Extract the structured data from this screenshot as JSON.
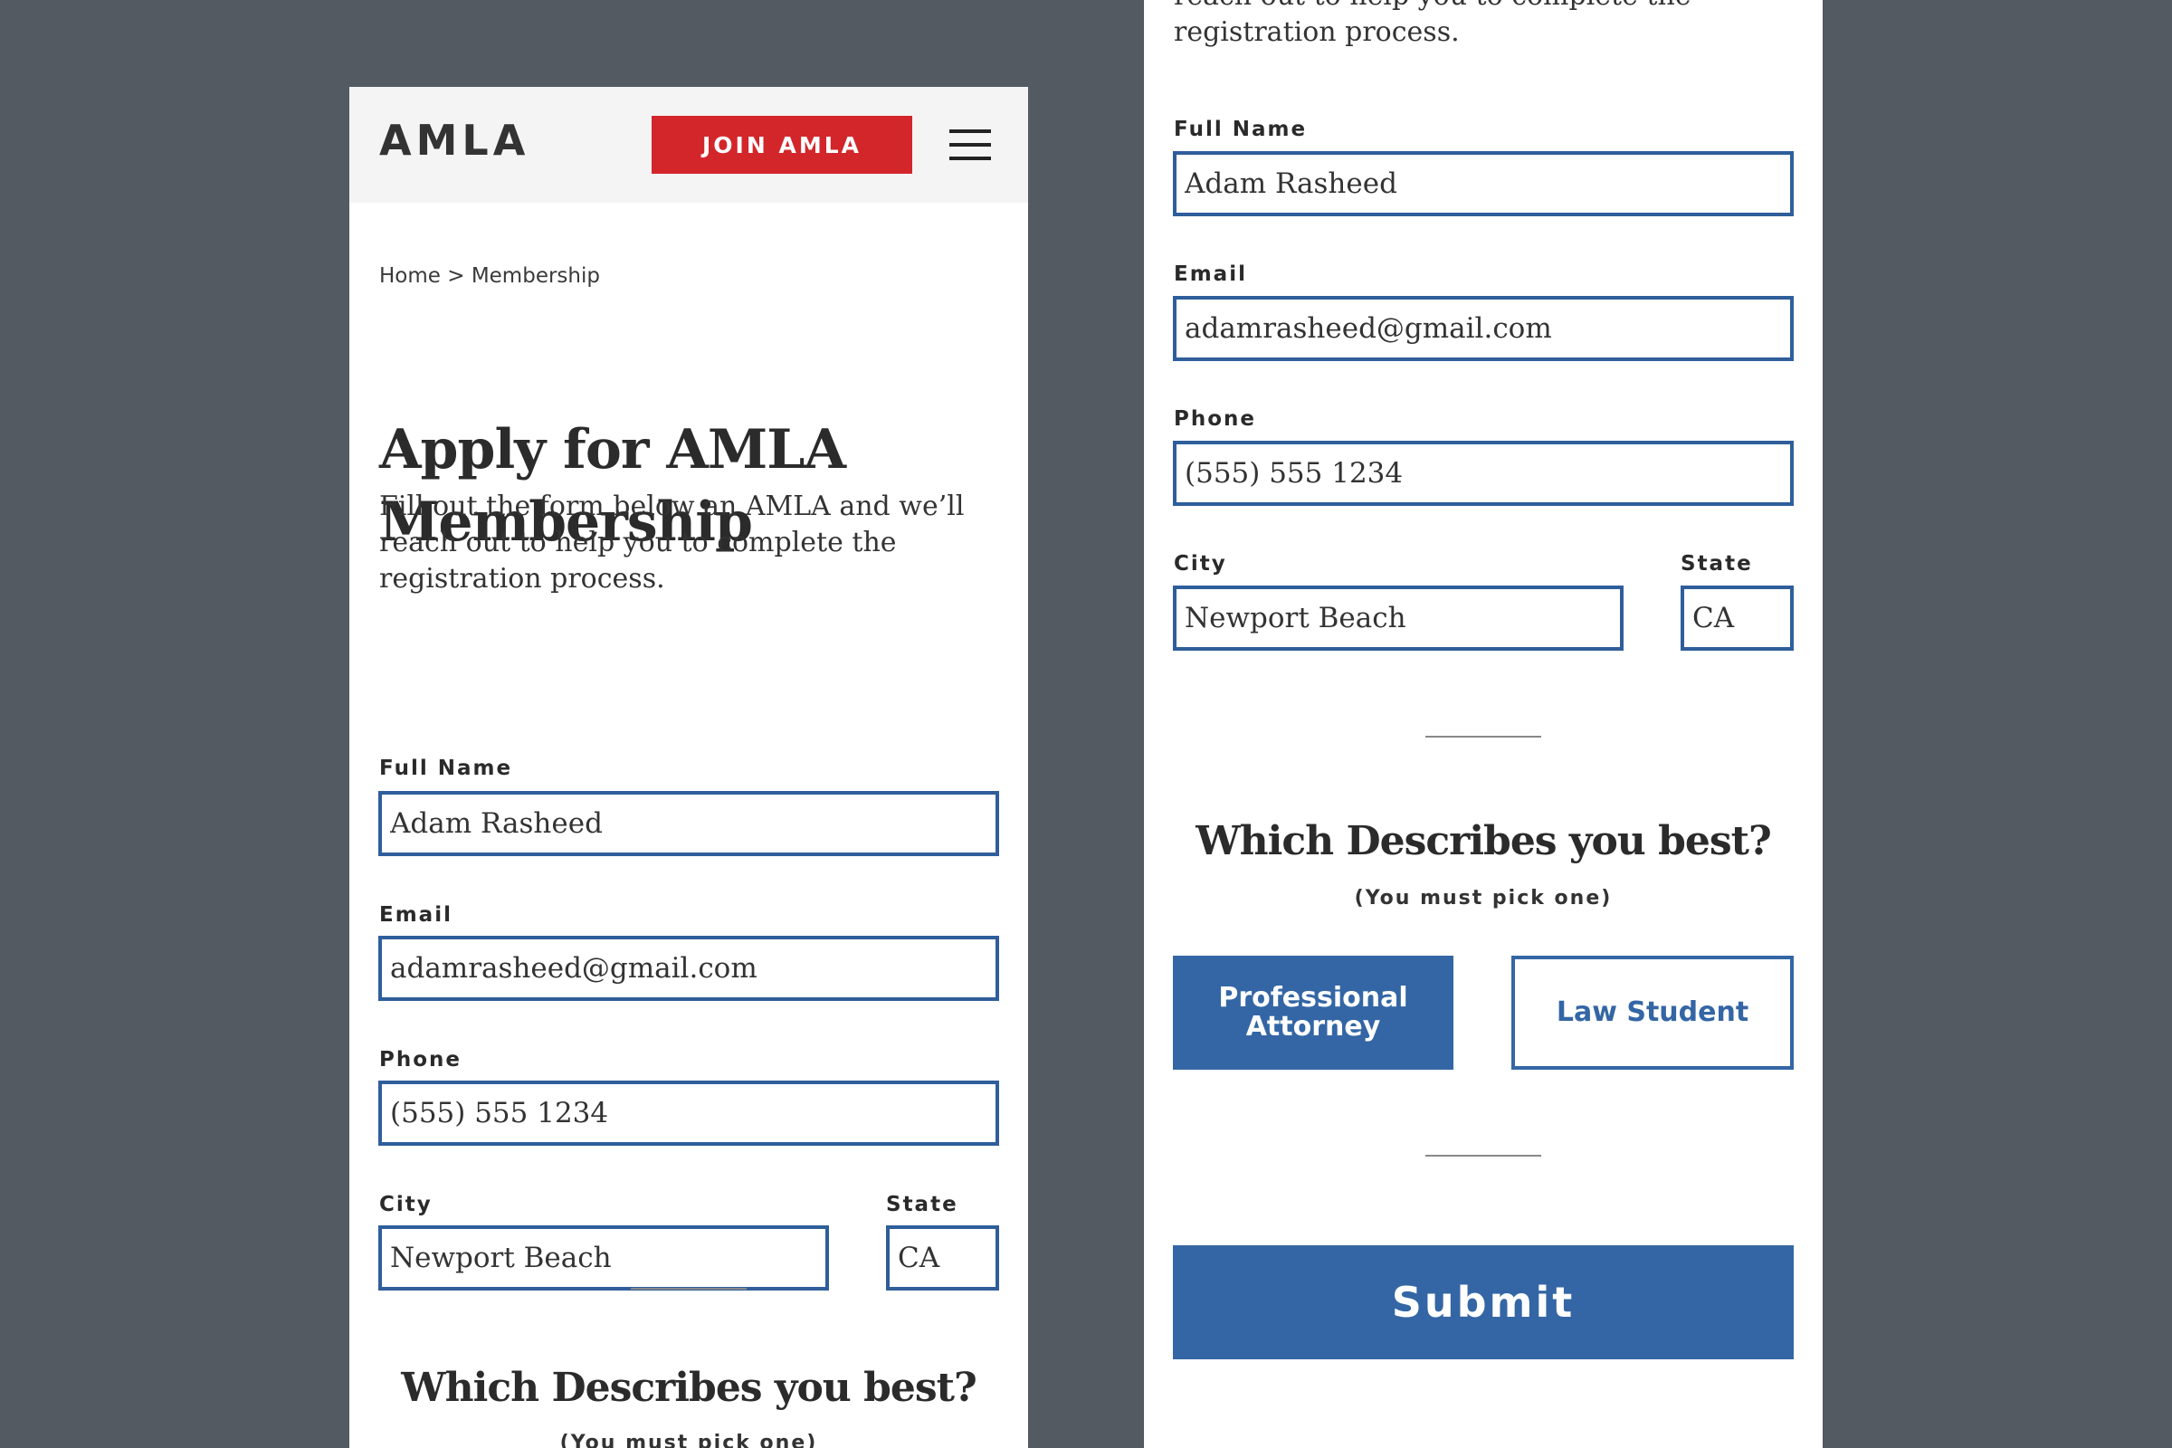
{
  "header": {
    "logo": "AMLA",
    "join_label": "JOIN AMLA"
  },
  "breadcrumb": "Home > Membership",
  "page": {
    "title": "Apply for AMLA Membership",
    "intro": "Fill out the form below an AMLA and we’ll reach out to help you to complete the registration process.",
    "intro_tail": "registration process.",
    "intro_tail_clipped": "reach out to help you to complete the"
  },
  "form": {
    "full_name": {
      "label": "Full Name",
      "value": "Adam Rasheed"
    },
    "email": {
      "label": "Email",
      "value": "adamrasheed@gmail.com"
    },
    "phone": {
      "label": "Phone",
      "value": "(555) 555 1234"
    },
    "city": {
      "label": "City",
      "value": "Newport Beach"
    },
    "state": {
      "label": "State",
      "value": "CA"
    }
  },
  "which": {
    "title": "Which Describes you best?",
    "subtitle": "(You must pick one)",
    "options": [
      "Professional Attorney",
      "Law Student"
    ],
    "selected": "Professional Attorney"
  },
  "submit_label": "Submit",
  "colors": {
    "background": "#545a61",
    "accent_blue": "#3466a5",
    "join_red": "#d3262a",
    "header_bg": "#f4f4f4"
  }
}
